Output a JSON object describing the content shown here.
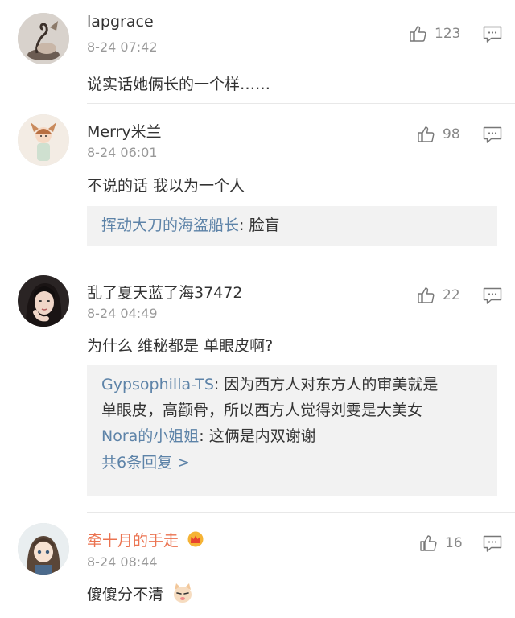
{
  "comments": [
    {
      "username": "lapgrace",
      "time": "8-24 07:42",
      "likes": "123",
      "text": "说实话她俩长的一个样……",
      "avatar_icon": "swan-figurine-avatar"
    },
    {
      "username": "Merry米兰",
      "time": "8-24 06:01",
      "likes": "98",
      "text": "不说的话 我以为一个人",
      "avatar_icon": "cartoon-girl-avatar",
      "replies": [
        {
          "user": "挥动大刀的海盗船长",
          "sep": ": ",
          "text": "脸盲"
        }
      ]
    },
    {
      "username": "乱了夏天蓝了海37472",
      "time": "8-24 04:49",
      "likes": "22",
      "text": "为什么 维秘都是 单眼皮啊?",
      "avatar_icon": "portrait-photo-avatar",
      "replies": [
        {
          "user": "Gypsophilla-TS",
          "sep": ": ",
          "text": "因为西方人对东方人的审美就是"
        },
        {
          "user": "",
          "sep": "",
          "text": "单眼皮，高颧骨，所以西方人觉得刘雯是大美女"
        },
        {
          "user": "Nora的小姐姐",
          "sep": ": ",
          "text": "这俩是内双谢谢"
        }
      ],
      "more_replies": "共6条回复 >"
    },
    {
      "username": "牵十月的手走",
      "time": "8-24 08:44",
      "likes": "16",
      "text": "傻傻分不清",
      "avatar_icon": "anime-girl-avatar",
      "badge_icon": "vip-crown-icon",
      "emoji_icon": "cat-face-emoji-icon"
    }
  ],
  "colors": {
    "link": "#5d83a8",
    "vip_name": "#eb7350",
    "meta": "#999999",
    "reply_bg": "#f2f2f2"
  }
}
